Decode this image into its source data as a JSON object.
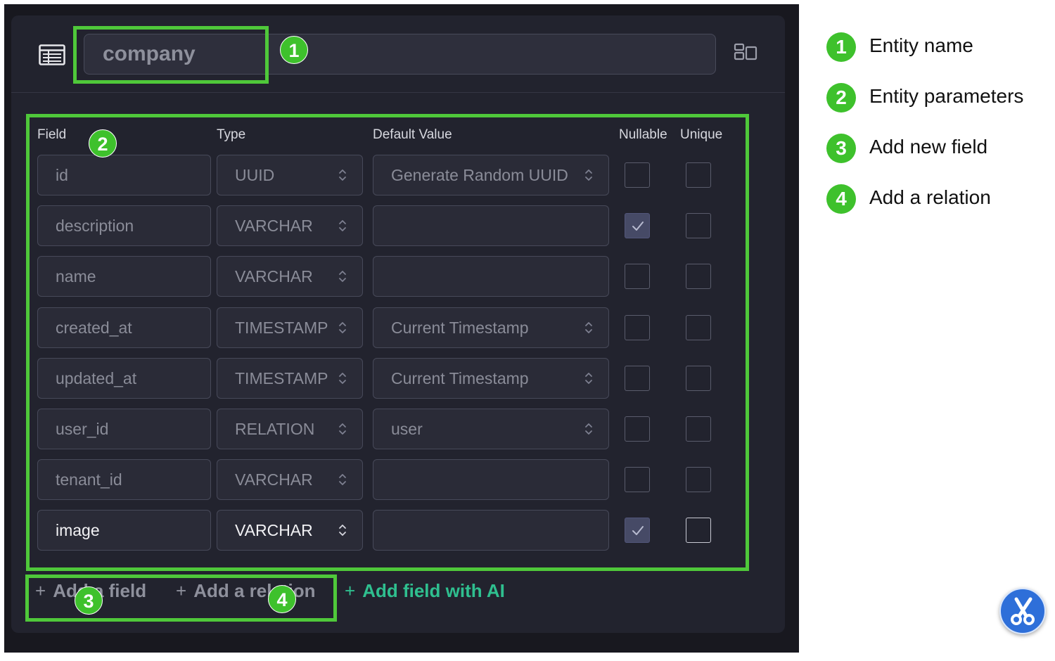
{
  "entity": {
    "name": "company"
  },
  "columns": {
    "field": "Field",
    "type": "Type",
    "default_value": "Default Value",
    "nullable": "Nullable",
    "unique": "Unique"
  },
  "rows": [
    {
      "field": "id",
      "type": "UUID",
      "default": "Generate Random UUID",
      "default_is_select": true,
      "nullable": false,
      "unique": false
    },
    {
      "field": "description",
      "type": "VARCHAR",
      "default": "",
      "default_is_select": false,
      "nullable": true,
      "unique": false
    },
    {
      "field": "name",
      "type": "VARCHAR",
      "default": "",
      "default_is_select": false,
      "nullable": false,
      "unique": false
    },
    {
      "field": "created_at",
      "type": "TIMESTAMP",
      "default": "Current Timestamp",
      "default_is_select": true,
      "nullable": false,
      "unique": false
    },
    {
      "field": "updated_at",
      "type": "TIMESTAMP",
      "default": "Current Timestamp",
      "default_is_select": true,
      "nullable": false,
      "unique": false
    },
    {
      "field": "user_id",
      "type": "RELATION",
      "default": "user",
      "default_is_select": true,
      "nullable": false,
      "unique": false
    },
    {
      "field": "tenant_id",
      "type": "VARCHAR",
      "default": "",
      "default_is_select": false,
      "nullable": false,
      "unique": false
    },
    {
      "field": "image",
      "type": "VARCHAR",
      "default": "",
      "default_is_select": false,
      "nullable": true,
      "unique": false,
      "active": true
    }
  ],
  "actions": {
    "add_field": "Add a field",
    "add_relation": "Add a relation",
    "add_field_ai": "Add field with AI",
    "plus": "+"
  },
  "annotations": {
    "badge_1": "1",
    "badge_2": "2",
    "badge_3": "3",
    "badge_4": "4"
  },
  "legend": [
    {
      "number": "1",
      "label": "Entity name"
    },
    {
      "number": "2",
      "label": "Entity parameters"
    },
    {
      "number": "3",
      "label": "Add new field"
    },
    {
      "number": "4",
      "label": "Add a relation"
    }
  ],
  "icons": {
    "table": "table-icon",
    "layout": "layout-toggle-icon",
    "select": "chevron-updown-icon",
    "check": "checkmark-icon",
    "bot": "scissors-logo-icon"
  },
  "colors": {
    "background": "#18181f",
    "panel": "#22232e",
    "highlight": "#4fc83a",
    "ai_accent": "#2fbf8f"
  }
}
